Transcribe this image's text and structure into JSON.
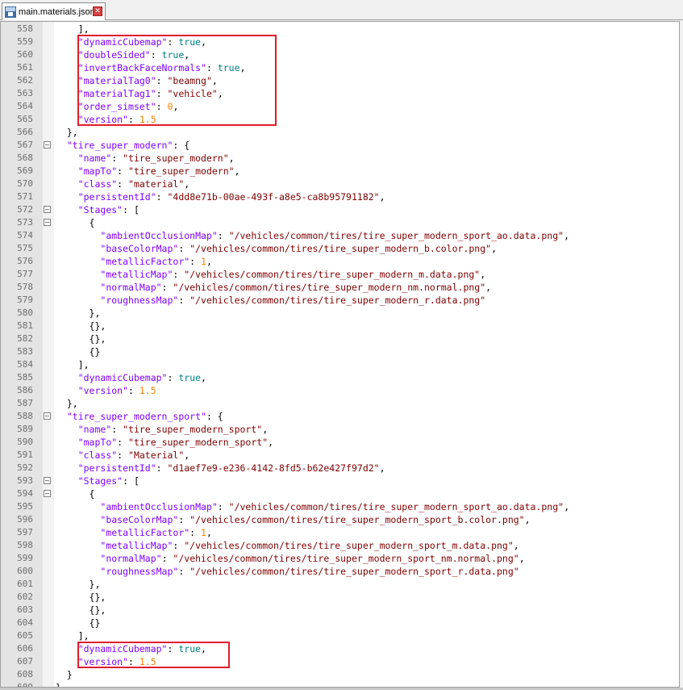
{
  "tab": {
    "label": "main.materials.json",
    "close_glyph": "✕",
    "icon": "save-file-icon"
  },
  "colors": {
    "key": "#8000ff",
    "string": "#800000",
    "keyword": "#008080",
    "number": "#ff8000",
    "highlight_box": "#e11d2b"
  },
  "lines": [
    {
      "n": "558",
      "fold": false,
      "t": [
        [
          "p",
          "    ],"
        ]
      ]
    },
    {
      "n": "559",
      "fold": false,
      "t": [
        [
          "p",
          "    "
        ],
        [
          "k",
          "\"dynamicCubemap\""
        ],
        [
          "p",
          ": "
        ],
        [
          "kw",
          "true"
        ],
        [
          "p",
          ","
        ]
      ]
    },
    {
      "n": "560",
      "fold": false,
      "t": [
        [
          "p",
          "    "
        ],
        [
          "k",
          "\"doubleSided\""
        ],
        [
          "p",
          ": "
        ],
        [
          "kw",
          "true"
        ],
        [
          "p",
          ","
        ]
      ]
    },
    {
      "n": "561",
      "fold": false,
      "t": [
        [
          "p",
          "    "
        ],
        [
          "k",
          "\"invertBackFaceNormals\""
        ],
        [
          "p",
          ": "
        ],
        [
          "kw",
          "true"
        ],
        [
          "p",
          ","
        ]
      ]
    },
    {
      "n": "562",
      "fold": false,
      "t": [
        [
          "p",
          "    "
        ],
        [
          "k",
          "\"materialTag0\""
        ],
        [
          "p",
          ": "
        ],
        [
          "s",
          "\"beamng\""
        ],
        [
          "p",
          ","
        ]
      ]
    },
    {
      "n": "563",
      "fold": false,
      "t": [
        [
          "p",
          "    "
        ],
        [
          "k",
          "\"materialTag1\""
        ],
        [
          "p",
          ": "
        ],
        [
          "s",
          "\"vehicle\""
        ],
        [
          "p",
          ","
        ]
      ]
    },
    {
      "n": "564",
      "fold": false,
      "t": [
        [
          "p",
          "    "
        ],
        [
          "k",
          "\"order_simset\""
        ],
        [
          "p",
          ": "
        ],
        [
          "n",
          "0"
        ],
        [
          "p",
          ","
        ]
      ]
    },
    {
      "n": "565",
      "fold": false,
      "t": [
        [
          "p",
          "    "
        ],
        [
          "k",
          "\"version\""
        ],
        [
          "p",
          ": "
        ],
        [
          "n",
          "1.5"
        ]
      ]
    },
    {
      "n": "566",
      "fold": false,
      "t": [
        [
          "p",
          "  },"
        ]
      ]
    },
    {
      "n": "567",
      "fold": true,
      "t": [
        [
          "p",
          "  "
        ],
        [
          "k",
          "\"tire_super_modern\""
        ],
        [
          "p",
          ": {"
        ]
      ]
    },
    {
      "n": "568",
      "fold": false,
      "t": [
        [
          "p",
          "    "
        ],
        [
          "k",
          "\"name\""
        ],
        [
          "p",
          ": "
        ],
        [
          "s",
          "\"tire_super_modern\""
        ],
        [
          "p",
          ","
        ]
      ]
    },
    {
      "n": "569",
      "fold": false,
      "t": [
        [
          "p",
          "    "
        ],
        [
          "k",
          "\"mapTo\""
        ],
        [
          "p",
          ": "
        ],
        [
          "s",
          "\"tire_super_modern\""
        ],
        [
          "p",
          ","
        ]
      ]
    },
    {
      "n": "570",
      "fold": false,
      "t": [
        [
          "p",
          "    "
        ],
        [
          "k",
          "\"class\""
        ],
        [
          "p",
          ": "
        ],
        [
          "s",
          "\"material\""
        ],
        [
          "p",
          ","
        ]
      ]
    },
    {
      "n": "571",
      "fold": false,
      "t": [
        [
          "p",
          "    "
        ],
        [
          "k",
          "\"persistentId\""
        ],
        [
          "p",
          ": "
        ],
        [
          "s",
          "\"4dd8e71b-00ae-493f-a8e5-ca8b95791182\""
        ],
        [
          "p",
          ","
        ]
      ]
    },
    {
      "n": "572",
      "fold": true,
      "t": [
        [
          "p",
          "    "
        ],
        [
          "k",
          "\"Stages\""
        ],
        [
          "p",
          ": ["
        ]
      ]
    },
    {
      "n": "573",
      "fold": true,
      "t": [
        [
          "p",
          "      {"
        ]
      ]
    },
    {
      "n": "574",
      "fold": false,
      "t": [
        [
          "p",
          "        "
        ],
        [
          "k",
          "\"ambientOcclusionMap\""
        ],
        [
          "p",
          ": "
        ],
        [
          "s",
          "\"/vehicles/common/tires/tire_super_modern_sport_ao.data.png\""
        ],
        [
          "p",
          ","
        ]
      ]
    },
    {
      "n": "575",
      "fold": false,
      "t": [
        [
          "p",
          "        "
        ],
        [
          "k",
          "\"baseColorMap\""
        ],
        [
          "p",
          ": "
        ],
        [
          "s",
          "\"/vehicles/common/tires/tire_super_modern_b.color.png\""
        ],
        [
          "p",
          ","
        ]
      ]
    },
    {
      "n": "576",
      "fold": false,
      "t": [
        [
          "p",
          "        "
        ],
        [
          "k",
          "\"metallicFactor\""
        ],
        [
          "p",
          ": "
        ],
        [
          "n",
          "1"
        ],
        [
          "p",
          ","
        ]
      ]
    },
    {
      "n": "577",
      "fold": false,
      "t": [
        [
          "p",
          "        "
        ],
        [
          "k",
          "\"metallicMap\""
        ],
        [
          "p",
          ": "
        ],
        [
          "s",
          "\"/vehicles/common/tires/tire_super_modern_m.data.png\""
        ],
        [
          "p",
          ","
        ]
      ]
    },
    {
      "n": "578",
      "fold": false,
      "t": [
        [
          "p",
          "        "
        ],
        [
          "k",
          "\"normalMap\""
        ],
        [
          "p",
          ": "
        ],
        [
          "s",
          "\"/vehicles/common/tires/tire_super_modern_nm.normal.png\""
        ],
        [
          "p",
          ","
        ]
      ]
    },
    {
      "n": "579",
      "fold": false,
      "t": [
        [
          "p",
          "        "
        ],
        [
          "k",
          "\"roughnessMap\""
        ],
        [
          "p",
          ": "
        ],
        [
          "s",
          "\"/vehicles/common/tires/tire_super_modern_r.data.png\""
        ]
      ]
    },
    {
      "n": "580",
      "fold": false,
      "t": [
        [
          "p",
          "      },"
        ]
      ]
    },
    {
      "n": "581",
      "fold": false,
      "t": [
        [
          "p",
          "      {},"
        ]
      ]
    },
    {
      "n": "582",
      "fold": false,
      "t": [
        [
          "p",
          "      {},"
        ]
      ]
    },
    {
      "n": "583",
      "fold": false,
      "t": [
        [
          "p",
          "      {}"
        ]
      ]
    },
    {
      "n": "584",
      "fold": false,
      "t": [
        [
          "p",
          "    ],"
        ]
      ]
    },
    {
      "n": "585",
      "fold": false,
      "t": [
        [
          "p",
          "    "
        ],
        [
          "k",
          "\"dynamicCubemap\""
        ],
        [
          "p",
          ": "
        ],
        [
          "kw",
          "true"
        ],
        [
          "p",
          ","
        ]
      ]
    },
    {
      "n": "586",
      "fold": false,
      "t": [
        [
          "p",
          "    "
        ],
        [
          "k",
          "\"version\""
        ],
        [
          "p",
          ": "
        ],
        [
          "n",
          "1.5"
        ]
      ]
    },
    {
      "n": "587",
      "fold": false,
      "t": [
        [
          "p",
          "  },"
        ]
      ]
    },
    {
      "n": "588",
      "fold": true,
      "t": [
        [
          "p",
          "  "
        ],
        [
          "k",
          "\"tire_super_modern_sport\""
        ],
        [
          "p",
          ": {"
        ]
      ]
    },
    {
      "n": "589",
      "fold": false,
      "t": [
        [
          "p",
          "    "
        ],
        [
          "k",
          "\"name\""
        ],
        [
          "p",
          ": "
        ],
        [
          "s",
          "\"tire_super_modern_sport\""
        ],
        [
          "p",
          ","
        ]
      ]
    },
    {
      "n": "590",
      "fold": false,
      "t": [
        [
          "p",
          "    "
        ],
        [
          "k",
          "\"mapTo\""
        ],
        [
          "p",
          ": "
        ],
        [
          "s",
          "\"tire_super_modern_sport\""
        ],
        [
          "p",
          ","
        ]
      ]
    },
    {
      "n": "591",
      "fold": false,
      "t": [
        [
          "p",
          "    "
        ],
        [
          "k",
          "\"class\""
        ],
        [
          "p",
          ": "
        ],
        [
          "s",
          "\"Material\""
        ],
        [
          "p",
          ","
        ]
      ]
    },
    {
      "n": "592",
      "fold": false,
      "t": [
        [
          "p",
          "    "
        ],
        [
          "k",
          "\"persistentId\""
        ],
        [
          "p",
          ": "
        ],
        [
          "s",
          "\"d1aef7e9-e236-4142-8fd5-b62e427f97d2\""
        ],
        [
          "p",
          ","
        ]
      ]
    },
    {
      "n": "593",
      "fold": true,
      "t": [
        [
          "p",
          "    "
        ],
        [
          "k",
          "\"Stages\""
        ],
        [
          "p",
          ": ["
        ]
      ]
    },
    {
      "n": "594",
      "fold": true,
      "t": [
        [
          "p",
          "      {"
        ]
      ]
    },
    {
      "n": "595",
      "fold": false,
      "t": [
        [
          "p",
          "        "
        ],
        [
          "k",
          "\"ambientOcclusionMap\""
        ],
        [
          "p",
          ": "
        ],
        [
          "s",
          "\"/vehicles/common/tires/tire_super_modern_sport_ao.data.png\""
        ],
        [
          "p",
          ","
        ]
      ]
    },
    {
      "n": "596",
      "fold": false,
      "t": [
        [
          "p",
          "        "
        ],
        [
          "k",
          "\"baseColorMap\""
        ],
        [
          "p",
          ": "
        ],
        [
          "s",
          "\"/vehicles/common/tires/tire_super_modern_sport_b.color.png\""
        ],
        [
          "p",
          ","
        ]
      ]
    },
    {
      "n": "597",
      "fold": false,
      "t": [
        [
          "p",
          "        "
        ],
        [
          "k",
          "\"metallicFactor\""
        ],
        [
          "p",
          ": "
        ],
        [
          "n",
          "1"
        ],
        [
          "p",
          ","
        ]
      ]
    },
    {
      "n": "598",
      "fold": false,
      "t": [
        [
          "p",
          "        "
        ],
        [
          "k",
          "\"metallicMap\""
        ],
        [
          "p",
          ": "
        ],
        [
          "s",
          "\"/vehicles/common/tires/tire_super_modern_sport_m.data.png\""
        ],
        [
          "p",
          ","
        ]
      ]
    },
    {
      "n": "599",
      "fold": false,
      "t": [
        [
          "p",
          "        "
        ],
        [
          "k",
          "\"normalMap\""
        ],
        [
          "p",
          ": "
        ],
        [
          "s",
          "\"/vehicles/common/tires/tire_super_modern_sport_nm.normal.png\""
        ],
        [
          "p",
          ","
        ]
      ]
    },
    {
      "n": "600",
      "fold": false,
      "t": [
        [
          "p",
          "        "
        ],
        [
          "k",
          "\"roughnessMap\""
        ],
        [
          "p",
          ": "
        ],
        [
          "s",
          "\"/vehicles/common/tires/tire_super_modern_sport_r.data.png\""
        ]
      ]
    },
    {
      "n": "601",
      "fold": false,
      "t": [
        [
          "p",
          "      },"
        ]
      ]
    },
    {
      "n": "602",
      "fold": false,
      "t": [
        [
          "p",
          "      {},"
        ]
      ]
    },
    {
      "n": "603",
      "fold": false,
      "t": [
        [
          "p",
          "      {},"
        ]
      ]
    },
    {
      "n": "604",
      "fold": false,
      "t": [
        [
          "p",
          "      {}"
        ]
      ]
    },
    {
      "n": "605",
      "fold": false,
      "t": [
        [
          "p",
          "    ],"
        ]
      ]
    },
    {
      "n": "606",
      "fold": false,
      "t": [
        [
          "p",
          "    "
        ],
        [
          "k",
          "\"dynamicCubemap\""
        ],
        [
          "p",
          ": "
        ],
        [
          "kw",
          "true"
        ],
        [
          "p",
          ","
        ]
      ]
    },
    {
      "n": "607",
      "fold": false,
      "t": [
        [
          "p",
          "    "
        ],
        [
          "k",
          "\"version\""
        ],
        [
          "p",
          ": "
        ],
        [
          "n",
          "1.5"
        ]
      ]
    },
    {
      "n": "608",
      "fold": false,
      "t": [
        [
          "p",
          "  }"
        ]
      ]
    },
    {
      "n": "609",
      "fold": false,
      "t": [
        [
          "p",
          "}"
        ]
      ]
    }
  ]
}
